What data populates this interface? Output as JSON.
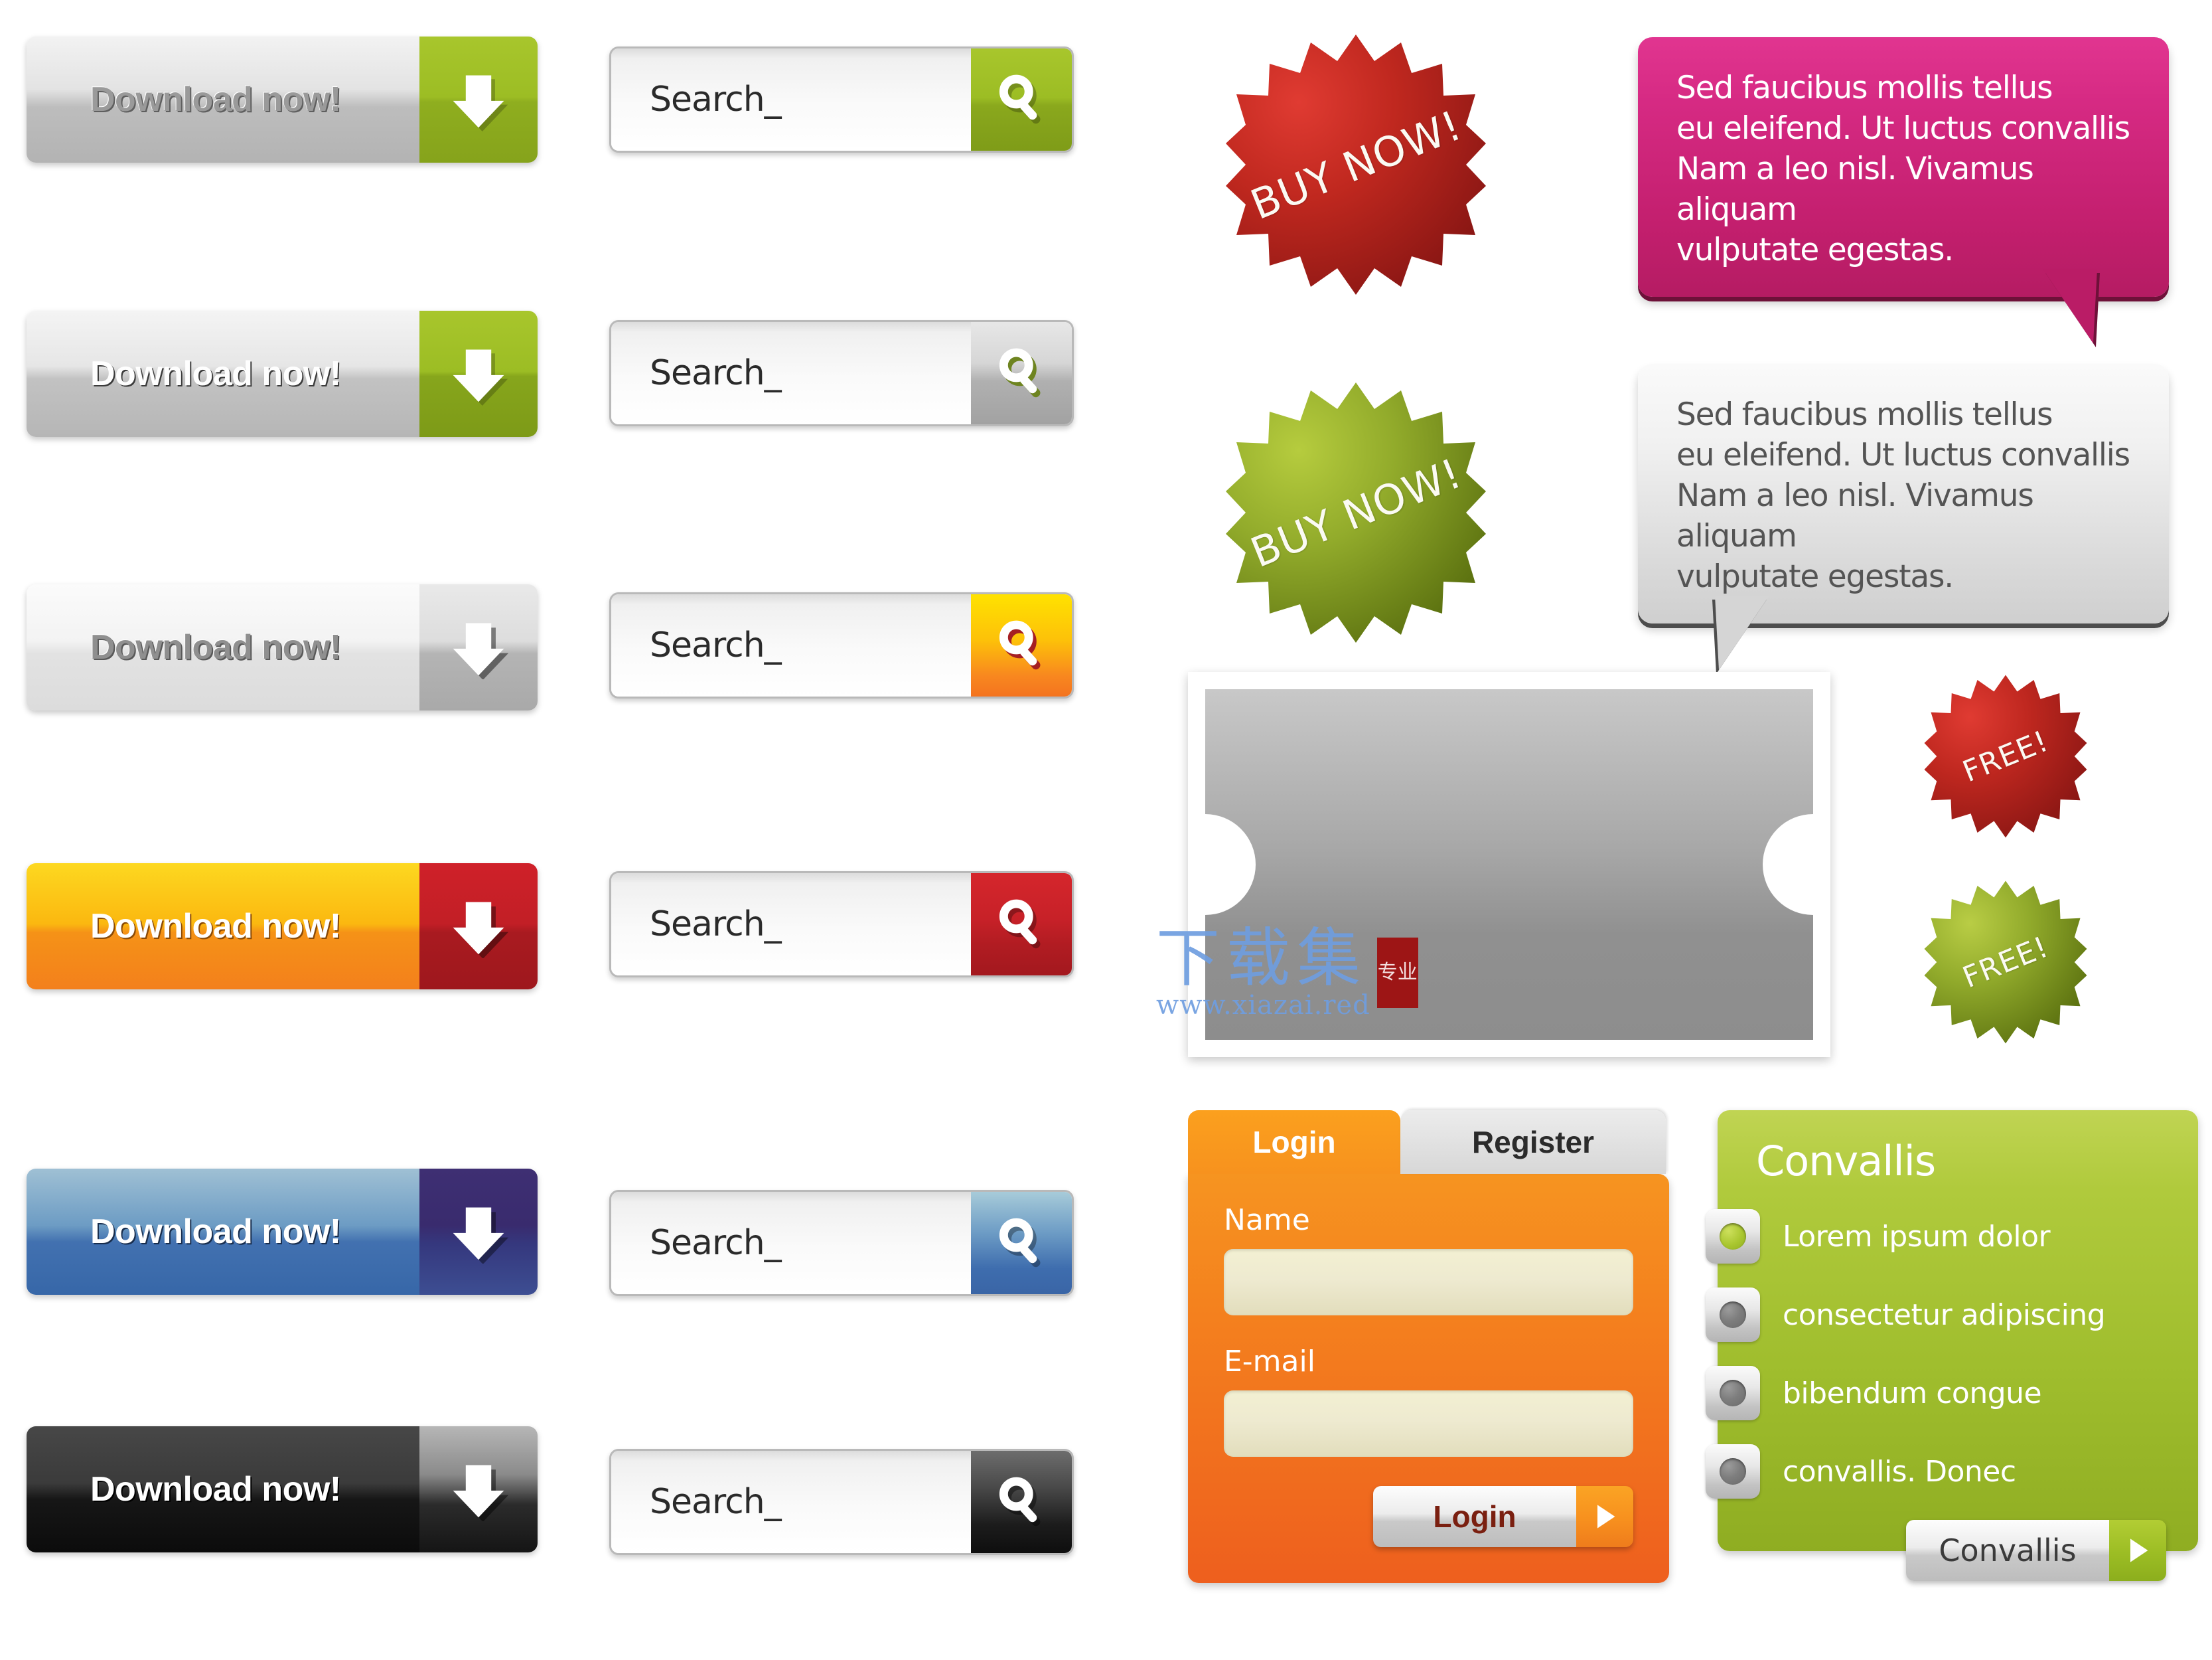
{
  "download_buttons": [
    {
      "label": "Download now!",
      "variant": "grey-green",
      "icon": "arrow-down-icon"
    },
    {
      "label": "Download now!",
      "variant": "grey-green-inset",
      "icon": "arrow-down-icon"
    },
    {
      "label": "Download now!",
      "variant": "white-grey",
      "icon": "arrow-down-icon"
    },
    {
      "label": "Download now!",
      "variant": "orange-red",
      "icon": "arrow-down-icon"
    },
    {
      "label": "Download now!",
      "variant": "blue-indigo",
      "icon": "arrow-down-icon"
    },
    {
      "label": "Download now!",
      "variant": "black-grey",
      "icon": "arrow-down-icon"
    }
  ],
  "search_boxes": [
    {
      "value": "Search_",
      "placeholder": "Search_",
      "accent": "#9cbd24",
      "accent_name": "green",
      "icon": "search-icon"
    },
    {
      "value": "Search_",
      "placeholder": "Search_",
      "accent": "#b0b0b0",
      "accent_name": "grey",
      "icon": "search-icon"
    },
    {
      "value": "Search_",
      "placeholder": "Search_",
      "accent": "#f8871f",
      "accent_name": "amber",
      "icon": "search-icon"
    },
    {
      "value": "Search_",
      "placeholder": "Search_",
      "accent": "#c72128",
      "accent_name": "red",
      "icon": "search-icon"
    },
    {
      "value": "Search_",
      "placeholder": "Search_",
      "accent": "#3e6dae",
      "accent_name": "blue",
      "icon": "search-icon"
    },
    {
      "value": "Search_",
      "placeholder": "Search_",
      "accent": "#1c1c1c",
      "accent_name": "black",
      "icon": "search-icon"
    }
  ],
  "badges": [
    {
      "label": "BUY NOW!",
      "color": "#b4231f",
      "color_name": "red",
      "size": "large"
    },
    {
      "label": "BUY NOW!",
      "color": "#7d9a20",
      "color_name": "green",
      "size": "large"
    },
    {
      "label": "FREE!",
      "color": "#b4231f",
      "color_name": "red",
      "size": "small"
    },
    {
      "label": "FREE!",
      "color": "#7d9a20",
      "color_name": "green",
      "size": "small"
    }
  ],
  "speech_bubbles": [
    {
      "text": "Sed faucibus mollis tellus\neu eleifend. Ut luctus convallis\nNam a leo nisl. Vivamus aliquam\nvulputate egestas.",
      "color": "#c31f6e",
      "color_name": "pink",
      "tail": "bottom-right"
    },
    {
      "text": "Sed faucibus mollis tellus\neu eleifend. Ut luctus convallis\nNam a leo nisl. Vivamus aliquam\nvulputate egestas.",
      "color": "#d9d9d9",
      "color_name": "grey",
      "tail": "bottom-left"
    }
  ],
  "carousel": {
    "prev_icon": "chevron-left-icon",
    "next_icon": "chevron-right-icon",
    "watermark": {
      "chinese": "下载集",
      "url": "www.xiazai.red",
      "seal": "专业"
    }
  },
  "login_panel": {
    "tabs": [
      {
        "label": "Login",
        "active": true
      },
      {
        "label": "Register",
        "active": false
      }
    ],
    "fields": [
      {
        "label": "Name",
        "value": "",
        "placeholder": ""
      },
      {
        "label": "E-mail",
        "value": "",
        "placeholder": ""
      }
    ],
    "submit": {
      "label": "Login",
      "icon": "arrow-right-icon"
    },
    "accent": "#f4801e"
  },
  "convallis_panel": {
    "title": "Convallis",
    "accent": "#9fbd2d",
    "items": [
      {
        "label": "Lorem   ipsum   dolor",
        "selected": true,
        "icon": "radio-button-icon"
      },
      {
        "label": "consectetur adipiscing",
        "selected": false,
        "icon": "radio-button-icon"
      },
      {
        "label": "bibendum   congue",
        "selected": false,
        "icon": "radio-button-icon"
      },
      {
        "label": "convallis.   Donec",
        "selected": false,
        "icon": "radio-button-icon"
      }
    ],
    "action": {
      "label": "Convallis",
      "icon": "arrow-right-icon"
    }
  }
}
